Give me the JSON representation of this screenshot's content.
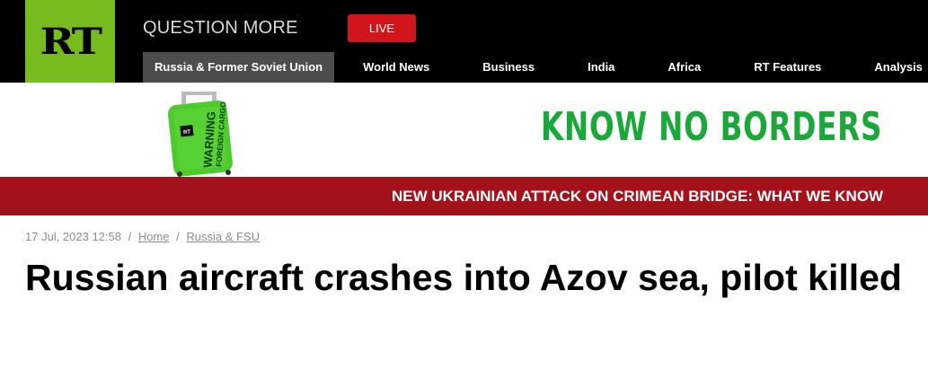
{
  "header": {
    "logo_text": "RT",
    "tagline": "QUESTION MORE",
    "live_label": "LIVE",
    "nav_items": [
      "Russia & Former Soviet Union",
      "World News",
      "Business",
      "India",
      "Africa",
      "RT Features",
      "Analysis"
    ]
  },
  "banner": {
    "suitcase_text": [
      "WARNING",
      "FOREIGN CARGO"
    ],
    "suitcase_logo": "RT",
    "slogan": "KNOW NO BORDERS"
  },
  "ticker": {
    "text": "NEW UKRAINIAN ATTACK ON CRIMEAN BRIDGE: WHAT WE KNOW"
  },
  "article": {
    "date": "17 Jul, 2023 12:58",
    "breadcrumb": [
      "Home",
      "Russia & FSU"
    ],
    "separator": "/",
    "title": "Russian aircraft crashes into Azov sea, pilot killed"
  },
  "colors": {
    "brand_green": "#77bc1f",
    "live_red": "#d0161b",
    "ticker_red": "#a3121b",
    "slogan_green": "#1aa83b"
  }
}
